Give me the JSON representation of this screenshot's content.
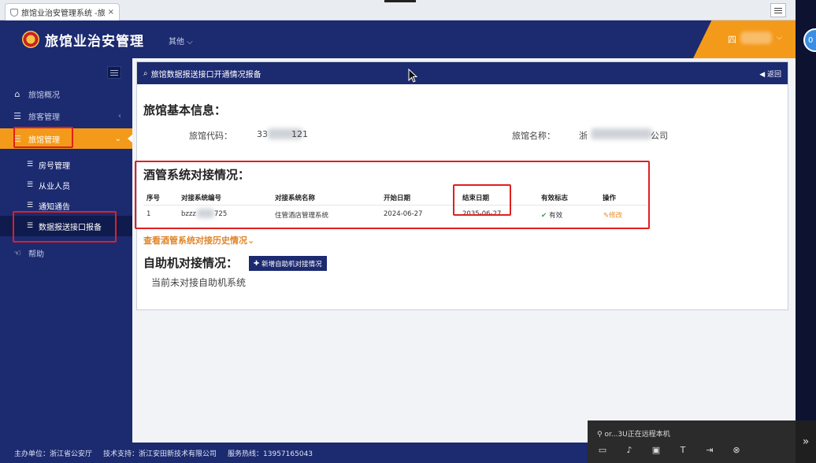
{
  "browser": {
    "tab_title": "旅馆业治安管理系统 -旅馆",
    "tab_close": "×"
  },
  "header": {
    "app_title": "旅馆业治安管理",
    "other_menu": "其他 ⌵",
    "user_name": "四"
  },
  "sidebar": {
    "items": [
      {
        "label": "旅馆概况",
        "icon": "home-icon"
      },
      {
        "label": "旅客管理",
        "icon": "list-icon"
      },
      {
        "label": "旅馆管理",
        "icon": "list-icon"
      },
      {
        "label": "帮助",
        "icon": "help-icon"
      }
    ],
    "subitems": [
      {
        "label": "房号管理"
      },
      {
        "label": "从业人员"
      },
      {
        "label": "通知通告"
      },
      {
        "label": "数据报送接口报备"
      }
    ]
  },
  "panel": {
    "title": "旅馆数据报送接口开通情况报备",
    "back_label": "返回",
    "basic_info_title": "旅馆基本信息：",
    "hotel_code_label": "旅馆代码：",
    "hotel_code_value_start": "33",
    "hotel_code_value_end": "121",
    "hotel_name_label": "旅馆名称：",
    "hotel_name_value_start": "浙",
    "hotel_name_value_end": "公司",
    "pms_title": "酒管系统对接情况：",
    "table": {
      "headers": [
        "序号",
        "对接系统编号",
        "对接系统名称",
        "开始日期",
        "结束日期",
        "有效标志",
        "操作"
      ],
      "rows": [
        {
          "no": "1",
          "sys_code_start": "bzzz",
          "sys_code_end": "725",
          "sys_name": "住管酒店管理系统",
          "start_date": "2024-06-27",
          "end_date": "2035-06-27",
          "valid": "有效",
          "action": "修改"
        }
      ]
    },
    "history_link": "查看酒管系统对接历史情况⌄",
    "kiosk_title": "自助机对接情况：",
    "add_kiosk_button": "新增自助机对接情况",
    "kiosk_empty": "当前未对接自助机系统"
  },
  "footer": {
    "host": "主办单位：浙江省公安厅",
    "support": "技术支持：浙江安田新技术有限公司",
    "hotline": "服务热线：13957165043"
  },
  "remote": {
    "title": "or...3U正在远程本机"
  },
  "colors": {
    "primary": "#1c2a70",
    "accent": "#f49a1a",
    "highlight": "#e02020"
  }
}
